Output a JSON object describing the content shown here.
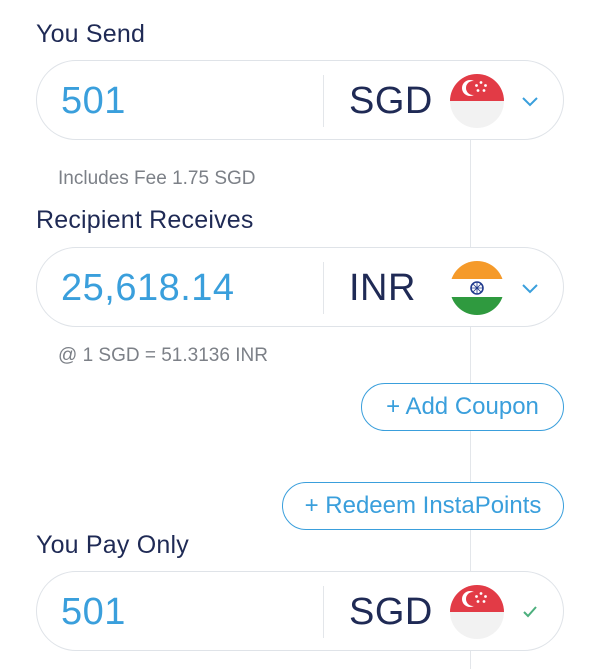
{
  "send": {
    "label": "You Send",
    "amount": "501",
    "currency": "SGD",
    "flag": "singapore-flag",
    "fee_note": "Includes Fee 1.75 SGD"
  },
  "receive": {
    "label": "Recipient Receives",
    "amount": "25,618.14",
    "currency": "INR",
    "flag": "india-flag",
    "rate_note": "@ 1 SGD = 51.3136 INR"
  },
  "buttons": {
    "add_coupon": "+ Add Coupon",
    "redeem_points": "+ Redeem InstaPoints"
  },
  "pay": {
    "label": "You Pay Only",
    "amount": "501",
    "currency": "SGD",
    "flag": "singapore-flag"
  },
  "colors": {
    "accent": "#3a9fdc",
    "navy": "#1f2a55",
    "muted": "#7c8087",
    "border": "#dfe3e8",
    "check": "#4caf7d"
  }
}
